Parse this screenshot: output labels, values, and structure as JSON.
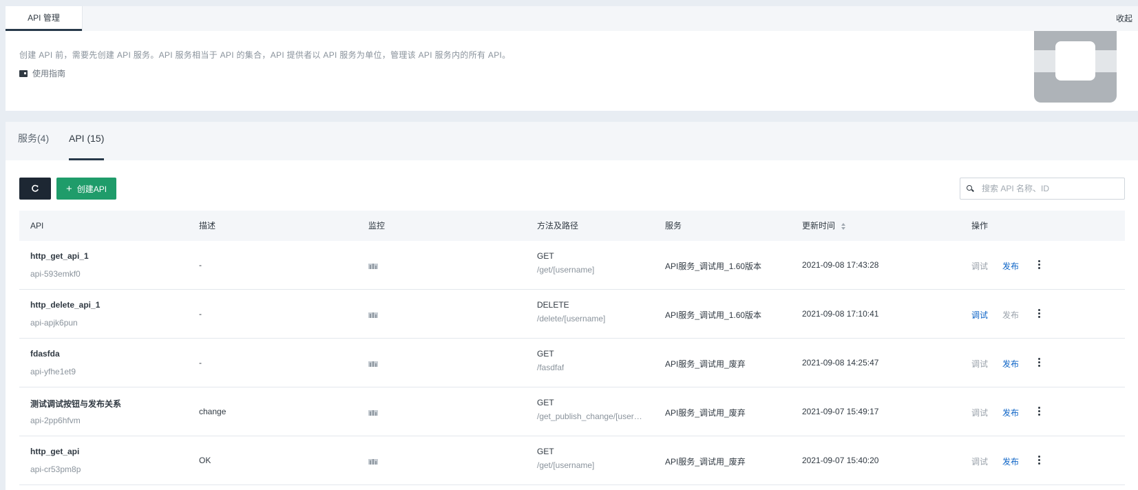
{
  "header": {
    "tab_label": "API 管理",
    "collapse_label": "收起",
    "intro": "创建 API 前，需要先创建 API 服务。API 服务相当于 API 的集合，API 提供者以 API 服务为单位，管理该 API 服务内的所有 API。",
    "guide_label": "使用指南"
  },
  "tabs": [
    {
      "label": "服务(4)",
      "active": false
    },
    {
      "label": "API (15)",
      "active": true
    }
  ],
  "toolbar": {
    "create_label": "创建API",
    "search_placeholder": "搜索 API 名称、ID"
  },
  "table": {
    "headers": {
      "api": "API",
      "desc": "描述",
      "monitor": "监控",
      "method_path": "方法及路径",
      "service": "服务",
      "updated": "更新时间",
      "ops": "操作"
    },
    "op_debug_label": "调试",
    "op_publish_label": "发布",
    "rows": [
      {
        "name": "http_get_api_1",
        "id": "api-593emkf0",
        "desc": "-",
        "method": "GET",
        "path": "/get/[username]",
        "service": "API服务_调试用_1.60版本",
        "updated": "2021-09-08 17:43:28",
        "debug_enabled": false,
        "publish_enabled": true
      },
      {
        "name": "http_delete_api_1",
        "id": "api-apjk6pun",
        "desc": "-",
        "method": "DELETE",
        "path": "/delete/[username]",
        "service": "API服务_调试用_1.60版本",
        "updated": "2021-09-08 17:10:41",
        "debug_enabled": true,
        "publish_enabled": false
      },
      {
        "name": "fdasfda",
        "id": "api-yfhe1et9",
        "desc": "-",
        "method": "GET",
        "path": "/fasdfaf",
        "service": "API服务_调试用_废弃",
        "updated": "2021-09-08 14:25:47",
        "debug_enabled": false,
        "publish_enabled": true
      },
      {
        "name": "测试调试按钮与发布关系",
        "id": "api-2pp6hfvm",
        "desc": "change",
        "method": "GET",
        "path": "/get_publish_change/[username]",
        "service": "API服务_调试用_废弃",
        "updated": "2021-09-07 15:49:17",
        "debug_enabled": false,
        "publish_enabled": true
      },
      {
        "name": "http_get_api",
        "id": "api-cr53pm8p",
        "desc": "OK",
        "method": "GET",
        "path": "/get/[username]",
        "service": "API服务_调试用_废弃",
        "updated": "2021-09-07 15:40:20",
        "debug_enabled": false,
        "publish_enabled": true
      }
    ]
  },
  "icons": {
    "refresh": "refresh-icon",
    "plus": "plus-icon",
    "search": "search-icon",
    "guide": "book-icon",
    "monitor": "bar-chart-icon",
    "more": "more-vertical-icon",
    "sort": "sort-icon"
  },
  "colors": {
    "primary_dark": "#1d2733",
    "create_green": "#1f9c6a",
    "link_blue": "#0c63c6",
    "disabled_gray": "#9aa2ab"
  }
}
